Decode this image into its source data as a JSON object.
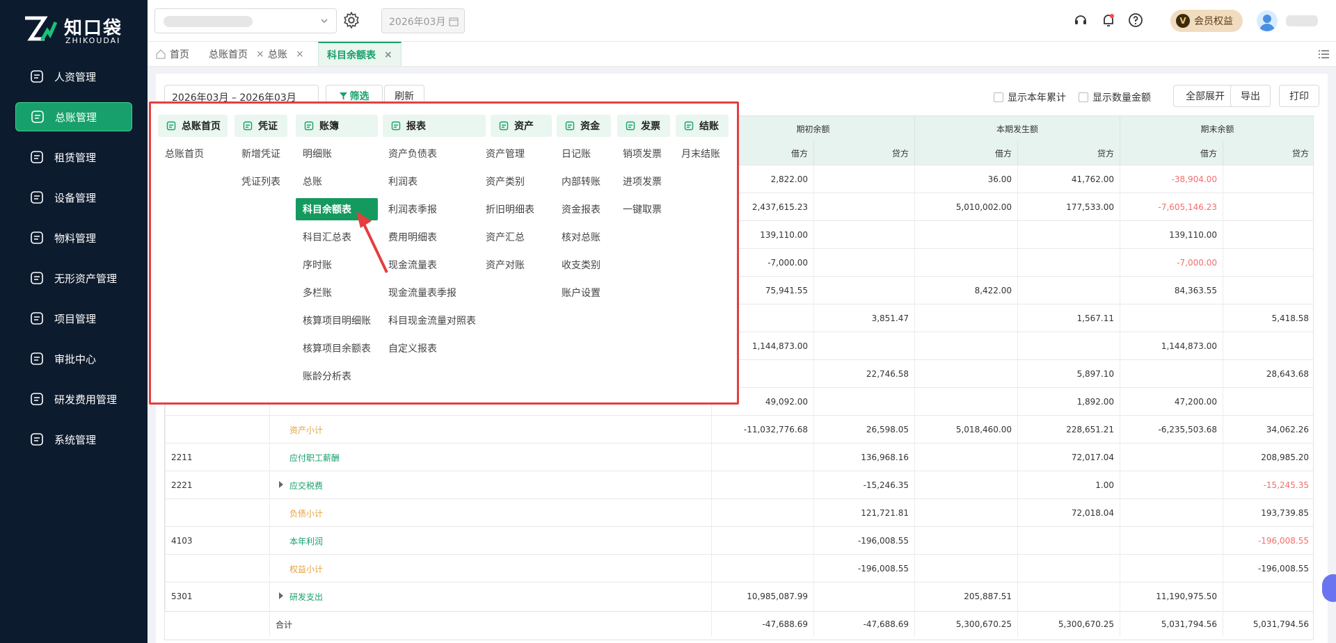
{
  "brand": {
    "name_cn": "知口袋",
    "name_en": "ZHIKOUDAI",
    "accent": "#17a06b"
  },
  "sidebar": {
    "items": [
      {
        "label": "人资管理",
        "icon": "user-circle-icon",
        "active": false
      },
      {
        "label": "总账管理",
        "icon": "ledger-icon",
        "active": true
      },
      {
        "label": "租赁管理",
        "icon": "lease-icon",
        "active": false
      },
      {
        "label": "设备管理",
        "icon": "device-icon",
        "active": false
      },
      {
        "label": "物料管理",
        "icon": "material-icon",
        "active": false
      },
      {
        "label": "无形资产管理",
        "icon": "intangible-asset-icon",
        "active": false
      },
      {
        "label": "项目管理",
        "icon": "project-icon",
        "active": false
      },
      {
        "label": "审批中心",
        "icon": "approval-icon",
        "active": false
      },
      {
        "label": "研发费用管理",
        "icon": "rd-expense-icon",
        "active": false
      },
      {
        "label": "系统管理",
        "icon": "settings-icon",
        "active": false
      }
    ]
  },
  "topbar": {
    "month": "2026年03月",
    "vip_badge": "V",
    "vip_label": "会员权益"
  },
  "tabs": [
    {
      "label": "首页",
      "closable": false,
      "active": false
    },
    {
      "label": "总账首页",
      "closable": true,
      "active": false
    },
    {
      "label": "总账",
      "closable": true,
      "active": false
    },
    {
      "label": "科目余额表",
      "closable": true,
      "active": true
    }
  ],
  "toolbar": {
    "date_range": "2026年03月 – 2026年03月",
    "filter_label": "筛选",
    "refresh_label": "刷新",
    "show_year_cumulative": "显示本年累计",
    "show_quantity_amount": "显示数量金额",
    "expand_all": "全部展开",
    "export": "导出",
    "print": "打印"
  },
  "table": {
    "group_headers": [
      "期初余额",
      "本期发生额",
      "期末余额"
    ],
    "sub_headers": [
      "借方",
      "贷方",
      "借方",
      "贷方",
      "借方",
      "贷方"
    ],
    "rows": [
      {
        "code": "",
        "name": "",
        "type": "hidden",
        "v": [
          "2,822.00",
          "",
          "36.00",
          "41,762.00",
          "-38,904.00",
          ""
        ],
        "red": [
          false,
          false,
          false,
          false,
          true,
          false
        ]
      },
      {
        "code": "",
        "name": "",
        "type": "hidden",
        "v": [
          "2,437,615.23",
          "",
          "5,010,002.00",
          "177,533.00",
          "-7,605,146.23",
          ""
        ],
        "red": [
          false,
          false,
          false,
          false,
          true,
          false
        ]
      },
      {
        "code": "",
        "name": "",
        "type": "hidden",
        "v": [
          "139,110.00",
          "",
          "",
          "",
          "139,110.00",
          ""
        ],
        "red": [
          false,
          false,
          false,
          false,
          false,
          false
        ]
      },
      {
        "code": "",
        "name": "",
        "type": "hidden",
        "v": [
          "-7,000.00",
          "",
          "",
          "",
          "-7,000.00",
          ""
        ],
        "red": [
          false,
          false,
          false,
          false,
          true,
          false
        ]
      },
      {
        "code": "",
        "name": "",
        "type": "hidden",
        "v": [
          "75,941.55",
          "",
          "8,422.00",
          "",
          "84,363.55",
          ""
        ],
        "red": [
          false,
          false,
          false,
          false,
          false,
          false
        ]
      },
      {
        "code": "",
        "name": "",
        "type": "hidden",
        "v": [
          "",
          "3,851.47",
          "",
          "1,567.11",
          "",
          "5,418.58"
        ],
        "red": [
          false,
          false,
          false,
          false,
          false,
          false
        ]
      },
      {
        "code": "",
        "name": "",
        "type": "hidden",
        "v": [
          "1,144,873.00",
          "",
          "",
          "",
          "1,144,873.00",
          ""
        ],
        "red": [
          false,
          false,
          false,
          false,
          false,
          false
        ]
      },
      {
        "code": "",
        "name": "",
        "type": "hidden",
        "v": [
          "",
          "22,746.58",
          "",
          "5,897.10",
          "",
          "28,643.68"
        ],
        "red": [
          false,
          false,
          false,
          false,
          false,
          false
        ]
      },
      {
        "code": "",
        "name": "",
        "type": "hidden",
        "v": [
          "49,092.00",
          "",
          "",
          "1,892.00",
          "47,200.00",
          ""
        ],
        "red": [
          false,
          false,
          false,
          false,
          false,
          false
        ]
      },
      {
        "code": "",
        "name": "资产小计",
        "type": "subtotal",
        "v": [
          "-11,032,776.68",
          "26,598.05",
          "5,018,460.00",
          "228,651.21",
          "-6,235,503.68",
          "34,062.26"
        ],
        "red": [
          false,
          false,
          false,
          false,
          false,
          false
        ]
      },
      {
        "code": "2211",
        "name": "应付职工薪酬",
        "type": "account",
        "v": [
          "",
          "136,968.16",
          "",
          "72,017.04",
          "",
          "208,985.20"
        ],
        "red": [
          false,
          false,
          false,
          false,
          false,
          false
        ]
      },
      {
        "code": "2221",
        "name": "应交税费",
        "type": "account-expandable",
        "v": [
          "",
          "-15,246.35",
          "",
          "1.00",
          "",
          "-15,245.35"
        ],
        "red": [
          false,
          false,
          false,
          false,
          false,
          true
        ]
      },
      {
        "code": "",
        "name": "负债小计",
        "type": "subtotal",
        "v": [
          "",
          "121,721.81",
          "",
          "72,018.04",
          "",
          "193,739.85"
        ],
        "red": [
          false,
          false,
          false,
          false,
          false,
          false
        ]
      },
      {
        "code": "4103",
        "name": "本年利润",
        "type": "account",
        "v": [
          "",
          "-196,008.55",
          "",
          "",
          "",
          "-196,008.55"
        ],
        "red": [
          false,
          false,
          false,
          false,
          false,
          true
        ]
      },
      {
        "code": "",
        "name": "权益小计",
        "type": "subtotal",
        "v": [
          "",
          "-196,008.55",
          "",
          "",
          "",
          "-196,008.55"
        ],
        "red": [
          false,
          false,
          false,
          false,
          false,
          false
        ]
      },
      {
        "code": "5301",
        "name": "研发支出",
        "type": "account-expandable",
        "v": [
          "10,985,087.99",
          "",
          "205,887.51",
          "",
          "11,190,975.50",
          ""
        ],
        "red": [
          false,
          false,
          false,
          false,
          false,
          false
        ]
      }
    ],
    "total": {
      "name": "合计",
      "v": [
        "-47,688.69",
        "-47,688.69",
        "5,300,670.25",
        "5,300,670.25",
        "5,031,794.56",
        "5,031,794.56"
      ]
    }
  },
  "mega_menu": {
    "columns": [
      {
        "header": "总账首页",
        "icon": "home-doc-icon",
        "items": [
          "总账首页"
        ]
      },
      {
        "header": "凭证",
        "icon": "voucher-icon",
        "items": [
          "新增凭证",
          "凭证列表"
        ]
      },
      {
        "header": "账簿",
        "icon": "book-icon",
        "items": [
          "明细账",
          "总账",
          "科目余额表",
          "科目汇总表",
          "序时账",
          "多栏账",
          "核算项目明细账",
          "核算项目余额表",
          "账龄分析表"
        ],
        "active_index": 2
      },
      {
        "header": "报表",
        "icon": "report-icon",
        "items": [
          "资产负债表",
          "利润表",
          "利润表季报",
          "费用明细表",
          "现金流量表",
          "现金流量表季报",
          "科目现金流量对照表",
          "自定义报表"
        ]
      },
      {
        "header": "资产",
        "icon": "asset-icon",
        "items": [
          "资产管理",
          "资产类别",
          "折旧明细表",
          "资产汇总",
          "资产对账"
        ]
      },
      {
        "header": "资金",
        "icon": "fund-icon",
        "items": [
          "日记账",
          "内部转账",
          "资金报表",
          "核对总账",
          "收支类别",
          "账户设置"
        ]
      },
      {
        "header": "发票",
        "icon": "invoice-icon",
        "items": [
          "销项发票",
          "进项发票",
          "一键取票"
        ]
      },
      {
        "header": "结账",
        "icon": "close-book-icon",
        "items": [
          "月末结账"
        ]
      }
    ]
  }
}
